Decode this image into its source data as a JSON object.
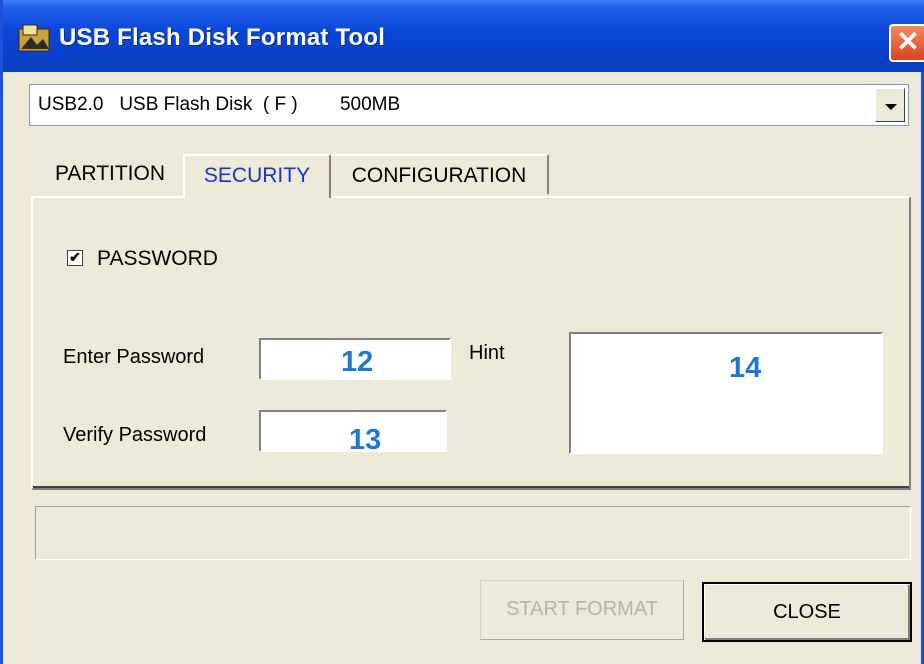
{
  "window": {
    "title": "USB Flash Disk Format Tool",
    "close_glyph": "✕"
  },
  "device": {
    "selected": "USB2.0   USB Flash Disk  ( F )        500MB"
  },
  "tabs": [
    {
      "label": "PARTITION",
      "active": false
    },
    {
      "label": "SECURITY",
      "active": true
    },
    {
      "label": "CONFIGURATION",
      "active": false
    }
  ],
  "security": {
    "password_checkbox_label": "PASSWORD",
    "password_checked": true,
    "enter_password_label": "Enter Password",
    "verify_password_label": "Verify Password",
    "hint_label": "Hint",
    "enter_password_marker": "12",
    "verify_password_marker": "13",
    "hint_marker": "14"
  },
  "buttons": {
    "start_format": "START FORMAT",
    "close": "CLOSE"
  },
  "colors": {
    "title_bar": "#0a46d8",
    "active_tab_text": "#1a34c8",
    "marker": "#1c78d4"
  }
}
